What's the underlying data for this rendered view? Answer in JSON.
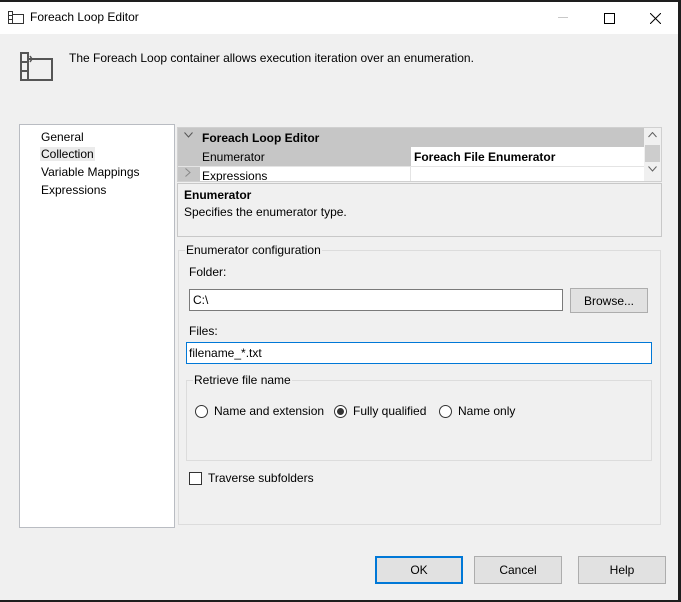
{
  "window": {
    "title": "Foreach Loop Editor",
    "icon": "foreach-loop-icon",
    "controls": {
      "minimize": "—",
      "maximize": "☐",
      "close": "✕"
    }
  },
  "header": {
    "icon": "foreach-loop-container-icon",
    "description": "The Foreach Loop container allows execution iteration over an enumeration."
  },
  "sidebar": {
    "selected": "Collection",
    "items": [
      {
        "label": "General"
      },
      {
        "label": "Collection"
      },
      {
        "label": "Variable Mappings"
      },
      {
        "label": "Expressions"
      }
    ]
  },
  "property_grid": {
    "category": {
      "label": "Foreach Loop Editor",
      "expanded": true,
      "chevron": "⌄"
    },
    "rows": [
      {
        "name": "Enumerator",
        "value": "Foreach File Enumerator"
      },
      {
        "name": "Expressions",
        "value": "",
        "expander": "›"
      }
    ],
    "scroll_up": "˄",
    "scroll_down": "˅"
  },
  "description_panel": {
    "title": "Enumerator",
    "text": "Specifies the enumerator type."
  },
  "enumerator_config": {
    "legend": "Enumerator configuration",
    "folder_label": "Folder:",
    "folder_value": "C:\\",
    "browse_label": "Browse...",
    "files_label": "Files:",
    "files_value": "filename_*.txt",
    "retrieve": {
      "legend": "Retrieve file name",
      "options": [
        {
          "label": "Name and extension",
          "selected": false
        },
        {
          "label": "Fully qualified",
          "selected": true
        },
        {
          "label": "Name only",
          "selected": false
        }
      ]
    },
    "traverse_label": "Traverse subfolders",
    "traverse_checked": false
  },
  "buttons": {
    "ok": "OK",
    "cancel": "Cancel",
    "help": "Help"
  }
}
